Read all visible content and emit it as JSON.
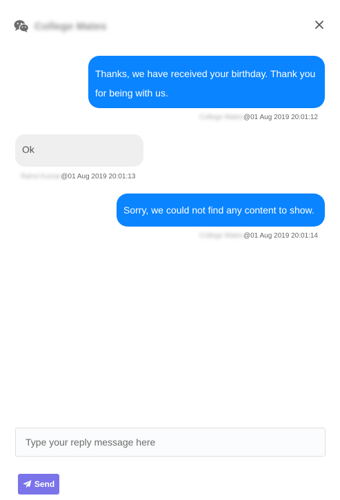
{
  "header": {
    "title": "College Mates",
    "chat_icon": "wechat-icon",
    "close_icon": "close-icon"
  },
  "messages": [
    {
      "direction": "outgoing",
      "text_line1": "Thanks, we have received your birthday. Thank you",
      "text_line2": "for being with us.",
      "sender": "College Mates",
      "timestamp": "@01 Aug 2019 20:01:12"
    },
    {
      "direction": "incoming",
      "text": "Ok",
      "sender": "Rahul Kumar",
      "timestamp": "@01 Aug 2019 20:01:13"
    },
    {
      "direction": "outgoing",
      "text": "Sorry, we could not find any content to show.",
      "sender": "College Mates",
      "timestamp": "@01 Aug 2019 20:01:14"
    }
  ],
  "composer": {
    "placeholder": "Type your reply message here",
    "value": "",
    "send_label": "Send",
    "send_icon": "paper-plane-icon"
  },
  "colors": {
    "outgoing_bubble": "#0a84ff",
    "incoming_bubble": "#efefef",
    "send_button": "#7a73ea"
  }
}
